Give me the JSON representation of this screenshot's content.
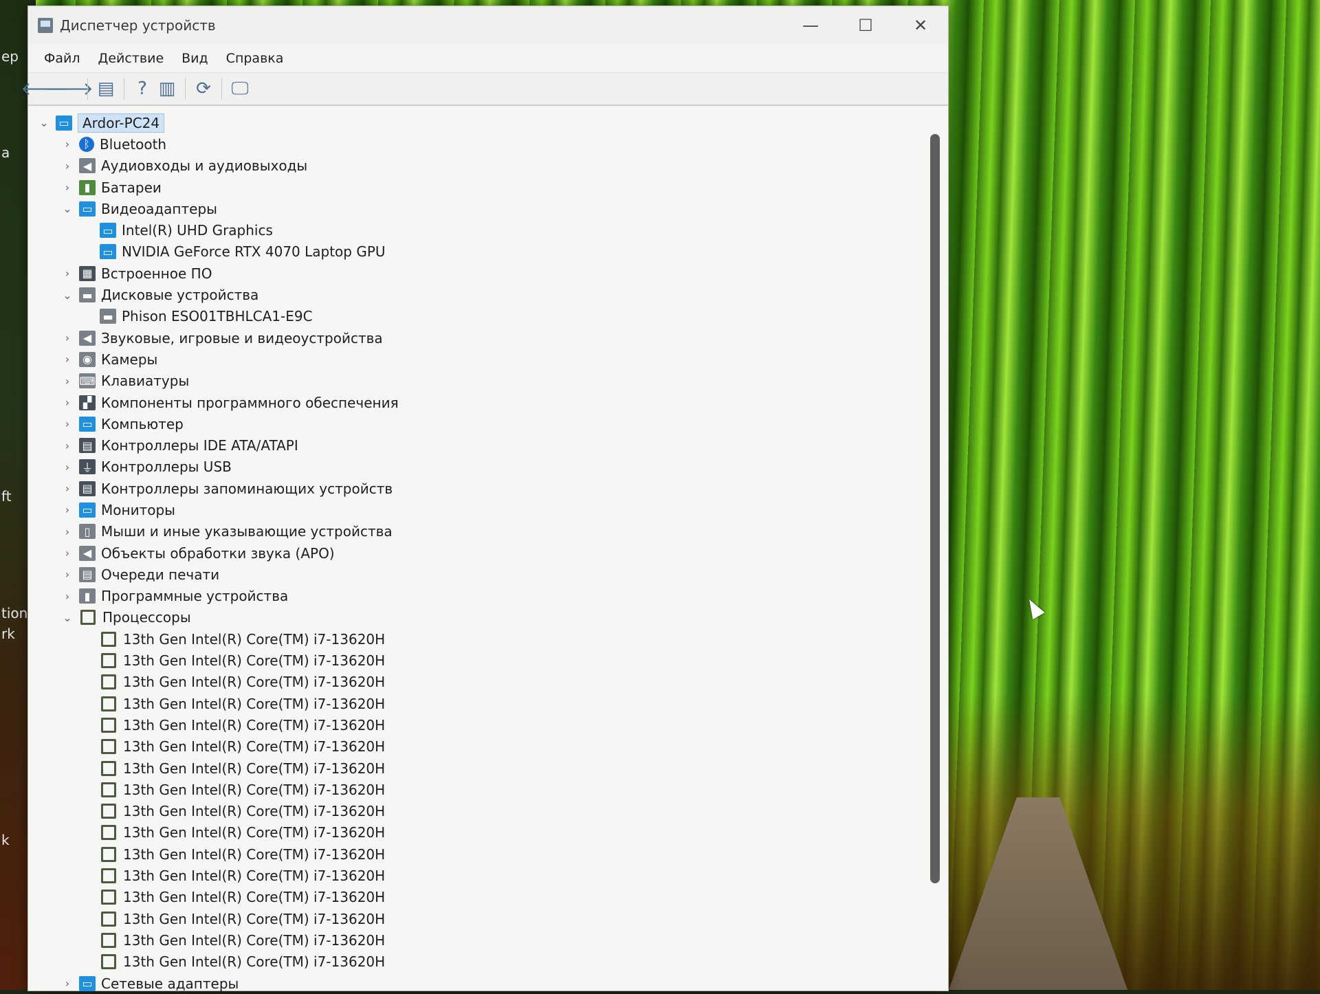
{
  "window": {
    "title": "Диспетчер устройств",
    "controls": {
      "minimize": "—",
      "maximize": "☐",
      "close": "✕"
    }
  },
  "menu": [
    "Файл",
    "Действие",
    "Вид",
    "Справка"
  ],
  "toolbar": {
    "back": "🡐",
    "forward": "🡒",
    "properties": "▤",
    "help": "?",
    "view": "▥",
    "update": "⟳",
    "monitor": "🖵"
  },
  "desktop": {
    "left_labels": [
      "ер",
      "а",
      "ft",
      "tion",
      "rk",
      "k"
    ]
  },
  "tree": {
    "root": "Ardor-PC24",
    "nodes": [
      {
        "label": "Bluetooth",
        "icon": "bluetooth-icon",
        "expanded": false,
        "children": []
      },
      {
        "label": "Аудиовходы и аудиовыходы",
        "icon": "speaker-icon",
        "expanded": false,
        "children": []
      },
      {
        "label": "Батареи",
        "icon": "battery-icon",
        "expanded": false,
        "children": []
      },
      {
        "label": "Видеоадаптеры",
        "icon": "display-adapter-icon",
        "expanded": true,
        "children": [
          "Intel(R) UHD Graphics",
          "NVIDIA GeForce RTX 4070 Laptop GPU"
        ]
      },
      {
        "label": "Встроенное ПО",
        "icon": "firmware-icon",
        "expanded": false,
        "children": []
      },
      {
        "label": "Дисковые устройства",
        "icon": "disk-icon",
        "expanded": true,
        "children": [
          "Phison ESO01TBHLCA1-E9C"
        ]
      },
      {
        "label": "Звуковые, игровые и видеоустройства",
        "icon": "speaker-icon",
        "expanded": false,
        "children": []
      },
      {
        "label": "Камеры",
        "icon": "camera-icon",
        "expanded": false,
        "children": []
      },
      {
        "label": "Клавиатуры",
        "icon": "keyboard-icon",
        "expanded": false,
        "children": []
      },
      {
        "label": "Компоненты программного обеспечения",
        "icon": "software-component-icon",
        "expanded": false,
        "children": []
      },
      {
        "label": "Компьютер",
        "icon": "computer-icon",
        "expanded": false,
        "children": []
      },
      {
        "label": "Контроллеры IDE ATA/ATAPI",
        "icon": "ide-controller-icon",
        "expanded": false,
        "children": []
      },
      {
        "label": "Контроллеры USB",
        "icon": "usb-icon",
        "expanded": false,
        "children": []
      },
      {
        "label": "Контроллеры запоминающих устройств",
        "icon": "storage-controller-icon",
        "expanded": false,
        "children": []
      },
      {
        "label": "Мониторы",
        "icon": "monitor-icon",
        "expanded": false,
        "children": []
      },
      {
        "label": "Мыши и иные указывающие устройства",
        "icon": "mouse-icon",
        "expanded": false,
        "children": []
      },
      {
        "label": "Объекты обработки звука (APO)",
        "icon": "speaker-icon",
        "expanded": false,
        "children": []
      },
      {
        "label": "Очереди печати",
        "icon": "printer-icon",
        "expanded": false,
        "children": []
      },
      {
        "label": "Программные устройства",
        "icon": "software-device-icon",
        "expanded": false,
        "children": []
      },
      {
        "label": "Процессоры",
        "icon": "processor-icon",
        "expanded": true,
        "children": [
          "13th Gen Intel(R) Core(TM) i7-13620H",
          "13th Gen Intel(R) Core(TM) i7-13620H",
          "13th Gen Intel(R) Core(TM) i7-13620H",
          "13th Gen Intel(R) Core(TM) i7-13620H",
          "13th Gen Intel(R) Core(TM) i7-13620H",
          "13th Gen Intel(R) Core(TM) i7-13620H",
          "13th Gen Intel(R) Core(TM) i7-13620H",
          "13th Gen Intel(R) Core(TM) i7-13620H",
          "13th Gen Intel(R) Core(TM) i7-13620H",
          "13th Gen Intel(R) Core(TM) i7-13620H",
          "13th Gen Intel(R) Core(TM) i7-13620H",
          "13th Gen Intel(R) Core(TM) i7-13620H",
          "13th Gen Intel(R) Core(TM) i7-13620H",
          "13th Gen Intel(R) Core(TM) i7-13620H",
          "13th Gen Intel(R) Core(TM) i7-13620H",
          "13th Gen Intel(R) Core(TM) i7-13620H"
        ]
      },
      {
        "label": "Сетевые адаптеры",
        "icon": "network-adapter-icon",
        "expanded": false,
        "children": []
      }
    ]
  },
  "colors": {
    "window_bg": "#f6f6f4",
    "selection": "#cfe3f7",
    "wallpaper_green": "#7bd21e"
  }
}
